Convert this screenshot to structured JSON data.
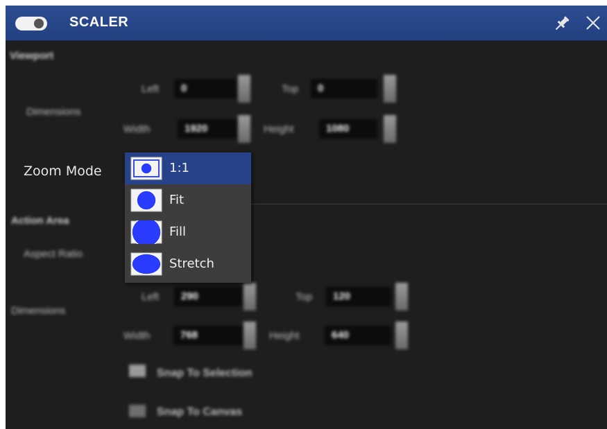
{
  "window": {
    "title": "SCALER",
    "toggle_state": "on",
    "pin_icon": "pin-icon",
    "close_icon": "close-icon"
  },
  "viewport": {
    "section_label": "Viewport",
    "dimensions_label": "Dimensions",
    "left_label": "Left",
    "left_value": "0",
    "top_label": "Top",
    "top_value": "0",
    "width_label": "Width",
    "width_value": "1920",
    "height_label": "Height",
    "height_value": "1080"
  },
  "zoom_mode": {
    "label": "Zoom Mode",
    "selected": "1:1",
    "options": [
      {
        "label": "1:1",
        "icon": "zoom-1to1-icon"
      },
      {
        "label": "Fit",
        "icon": "zoom-fit-icon"
      },
      {
        "label": "Fill",
        "icon": "zoom-fill-icon"
      },
      {
        "label": "Stretch",
        "icon": "zoom-stretch-icon"
      }
    ]
  },
  "action_area": {
    "section_label": "Action Area",
    "aspect_ratio_label": "Aspect Ratio",
    "dimensions_label": "Dimensions",
    "left_label": "Left",
    "left_value": "290",
    "top_label": "Top",
    "top_value": "120",
    "width_label": "Width",
    "width_value": "768",
    "height_label": "Height",
    "height_value": "640",
    "snap_selection_label": "Snap To Selection",
    "snap_canvas_label": "Snap To Canvas"
  },
  "colors": {
    "titlebar": "#22407f",
    "panel_bg": "#1e1e1e",
    "selected_item": "#28428a",
    "icon_blue": "#2a3dff"
  }
}
